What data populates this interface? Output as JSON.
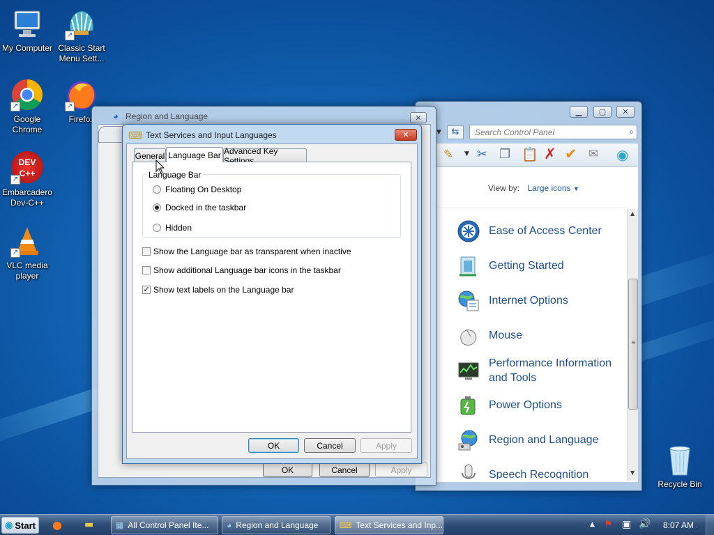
{
  "desktop": {
    "icons": [
      {
        "label": "My Computer",
        "icon": "computer-icon"
      },
      {
        "label": "Classic Start Menu Sett...",
        "icon": "shell-icon"
      },
      {
        "label": "Google Chrome",
        "icon": "chrome-icon"
      },
      {
        "label": "Firefox",
        "icon": "firefox-icon"
      },
      {
        "label": "Embarcadero Dev-C++",
        "icon": "devcpp-icon",
        "glyph_text": "DEV C++"
      },
      {
        "label": "VLC media player",
        "icon": "vlc-icon"
      },
      {
        "label": "Recycle Bin",
        "icon": "recycle-bin-icon"
      }
    ]
  },
  "control_panel": {
    "search_placeholder": "Search Control Panel",
    "view_by_label": "View by:",
    "view_by_value": "Large icons",
    "items": [
      {
        "label": "Ease of Access Center",
        "icon": "ease-of-access-icon"
      },
      {
        "label": "Getting Started",
        "icon": "getting-started-icon"
      },
      {
        "label": "Internet Options",
        "icon": "internet-options-icon"
      },
      {
        "label": "Mouse",
        "icon": "mouse-icon"
      },
      {
        "label": "Performance Information and Tools",
        "icon": "performance-icon"
      },
      {
        "label": "Power Options",
        "icon": "power-options-icon"
      },
      {
        "label": "Region and Language",
        "icon": "region-language-icon"
      },
      {
        "label": "Speech Recognition",
        "icon": "speech-recognition-icon"
      }
    ]
  },
  "region_dialog": {
    "title": "Region and Language",
    "buttons": {
      "ok": "OK",
      "cancel": "Cancel",
      "apply": "Apply"
    }
  },
  "text_services_dialog": {
    "title": "Text Services and Input Languages",
    "tabs": [
      "General",
      "Language Bar",
      "Advanced Key Settings"
    ],
    "active_tab": "Language Bar",
    "group_label": "Language Bar",
    "radios": [
      {
        "label": "Floating On Desktop",
        "checked": false
      },
      {
        "label": "Docked in the taskbar",
        "checked": true
      },
      {
        "label": "Hidden",
        "checked": false
      }
    ],
    "checkboxes": [
      {
        "label": "Show the Language bar as transparent when inactive",
        "checked": false
      },
      {
        "label": "Show additional Language bar icons in the taskbar",
        "checked": false
      },
      {
        "label": "Show text labels on the Language bar",
        "checked": true
      }
    ],
    "buttons": {
      "ok": "OK",
      "cancel": "Cancel",
      "apply": "Apply"
    }
  },
  "taskbar": {
    "start_label": "Start",
    "tasks": [
      {
        "label": "All Control Panel Ite...",
        "icon": "control-panel-icon"
      },
      {
        "label": "Region and Language",
        "icon": "globe-icon"
      },
      {
        "label": "Text Services and Inp...",
        "icon": "keyboard-icon"
      }
    ],
    "clock": "8:07 AM"
  }
}
